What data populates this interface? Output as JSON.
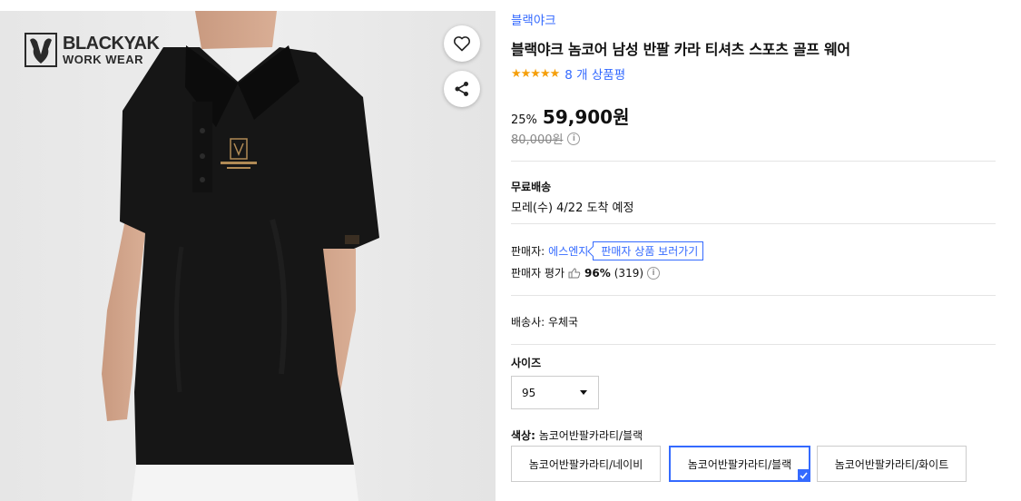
{
  "image_area": {
    "logo_brand": "BLACKYAK",
    "logo_sub": "WORK WEAR",
    "heart_icon": "heart-outline-icon",
    "share_icon": "share-icon"
  },
  "product": {
    "brand": "블랙야크",
    "title": "블랙야크 놈코어 남성 반팔 카라 티셔츠 스포츠 골프 웨어",
    "stars": "★★★★★",
    "review_count": "8 개 상품평",
    "discount": "25%",
    "sale_price": "59,900원",
    "original_price": "80,000원",
    "info_icon": "i"
  },
  "shipping": {
    "label": "무료배송",
    "date": "모레(수) 4/22 도착 예정"
  },
  "seller": {
    "prefix": "판매자:",
    "name": "에스엔지",
    "link": "판매자 상품 보러가기",
    "eval_label": "판매자 평가",
    "eval_pct": "96%",
    "eval_count": "(319)",
    "thumb_icon": "thumbs-up-icon"
  },
  "courier": "배송사:  우체국",
  "options": {
    "size_label": "사이즈",
    "size_value": "95",
    "color_label_bold": "색상:",
    "color_label_value": "놈코어반팔카라티/블랙",
    "colors": [
      "놈코어반팔카라티/네이비",
      "놈코어반팔카라티/블랙",
      "놈코어반팔카라티/화이트"
    ]
  },
  "colors": {
    "accent": "#346aff",
    "star": "#f59f0a",
    "shirt": "#161616",
    "logo_gold": "#b08a55"
  }
}
